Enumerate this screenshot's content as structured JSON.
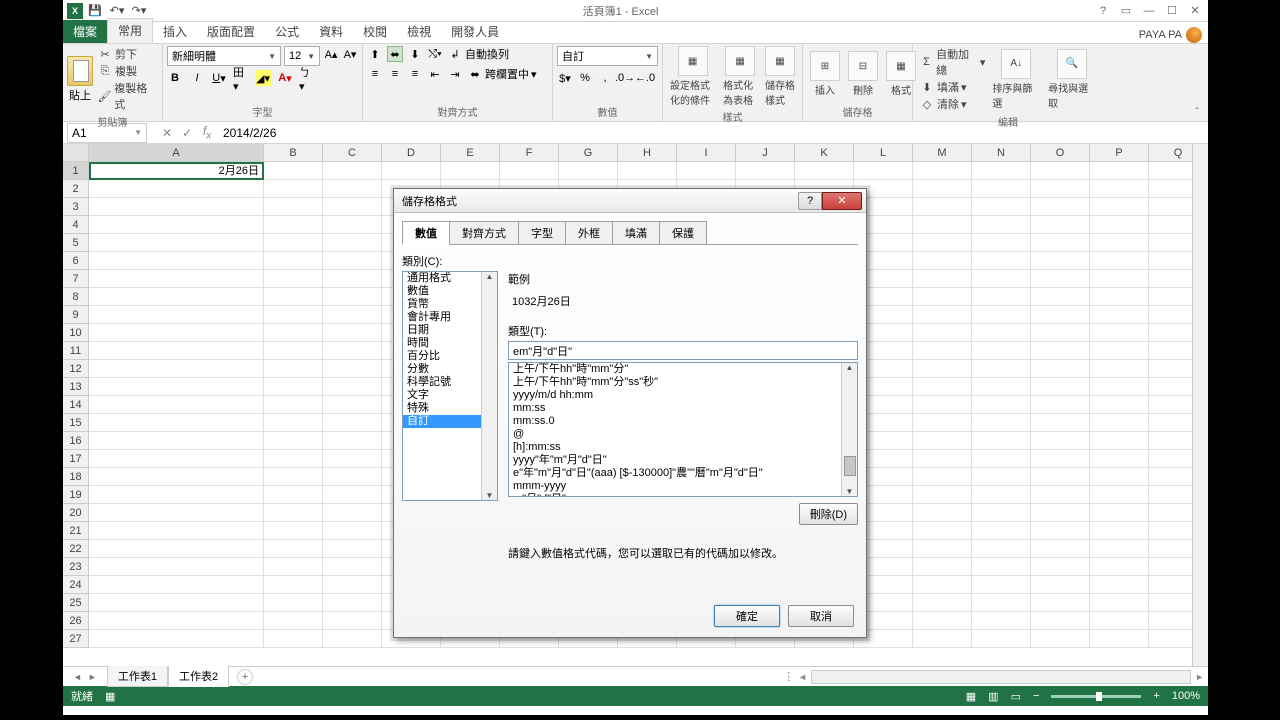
{
  "titlebar": {
    "title": "活頁簿1 - Excel"
  },
  "user": {
    "name": "PAYA PA"
  },
  "tabs": {
    "file": "檔案",
    "home": "常用",
    "insert": "插入",
    "layout": "版面配置",
    "formulas": "公式",
    "data": "資料",
    "review": "校閱",
    "view": "檢視",
    "developer": "開發人員"
  },
  "ribbon": {
    "clipboard": {
      "label": "剪貼簿",
      "paste": "貼上",
      "cut": "剪下",
      "copy": "複製",
      "painter": "複製格式"
    },
    "font": {
      "label": "字型",
      "name": "新細明體",
      "size": "12"
    },
    "alignment": {
      "label": "對齊方式",
      "wrap": "自動換列",
      "merge": "跨欄置中"
    },
    "number": {
      "label": "數值",
      "format": "自訂"
    },
    "styles": {
      "label": "樣式",
      "cond": "設定格式化的條件",
      "table": "格式化為表格",
      "cell": "儲存格樣式"
    },
    "cells": {
      "label": "儲存格",
      "insert": "插入",
      "delete": "刪除",
      "format": "格式"
    },
    "editing": {
      "label": "編輯",
      "sum": "自動加總",
      "fill": "填滿",
      "clear": "清除",
      "sort": "排序與篩選",
      "find": "尋找與選取"
    }
  },
  "formula_bar": {
    "cell_ref": "A1",
    "value": "2014/2/26"
  },
  "grid": {
    "cols": [
      "A",
      "B",
      "C",
      "D",
      "E",
      "F",
      "G",
      "H",
      "I",
      "J",
      "K",
      "L",
      "M",
      "N",
      "O",
      "P",
      "Q"
    ],
    "colw_first": 175,
    "a1_display": "2月26日"
  },
  "sheets": {
    "tab1": "工作表1",
    "tab2": "工作表2"
  },
  "status": {
    "mode": "就緒",
    "zoom": "100%"
  },
  "dialog": {
    "title": "儲存格格式",
    "tabs": {
      "number": "數值",
      "alignment": "對齊方式",
      "font": "字型",
      "border": "外框",
      "fill": "填滿",
      "protection": "保護"
    },
    "category_label": "類別(C):",
    "categories": [
      "通用格式",
      "數值",
      "貨幣",
      "會計專用",
      "日期",
      "時間",
      "百分比",
      "分數",
      "科學記號",
      "文字",
      "特殊",
      "自訂"
    ],
    "selected_category": "自訂",
    "sample_label": "範例",
    "sample_value": "1032月26日",
    "type_label": "類型(T):",
    "type_value": "em\"月\"d\"日\"",
    "type_items": [
      "上午/下午hh\"時\"mm\"分\"",
      "上午/下午hh\"時\"mm\"分\"ss\"秒\"",
      "yyyy/m/d hh:mm",
      "mm:ss",
      "mm:ss.0",
      "@",
      "[h]:mm:ss",
      "yyyy\"年\"m\"月\"d\"日\"",
      "e\"年\"m\"月\"d\"日\"(aaa) [$-130000]\"農\"\"曆\"m\"月\"d\"日\"",
      "mmm-yyyy",
      "m\"月\"d\"日\""
    ],
    "delete_btn": "刪除(D)",
    "help_text": "請鍵入數值格式代碼，您可以選取已有的代碼加以修改。",
    "ok": "確定",
    "cancel": "取消"
  }
}
